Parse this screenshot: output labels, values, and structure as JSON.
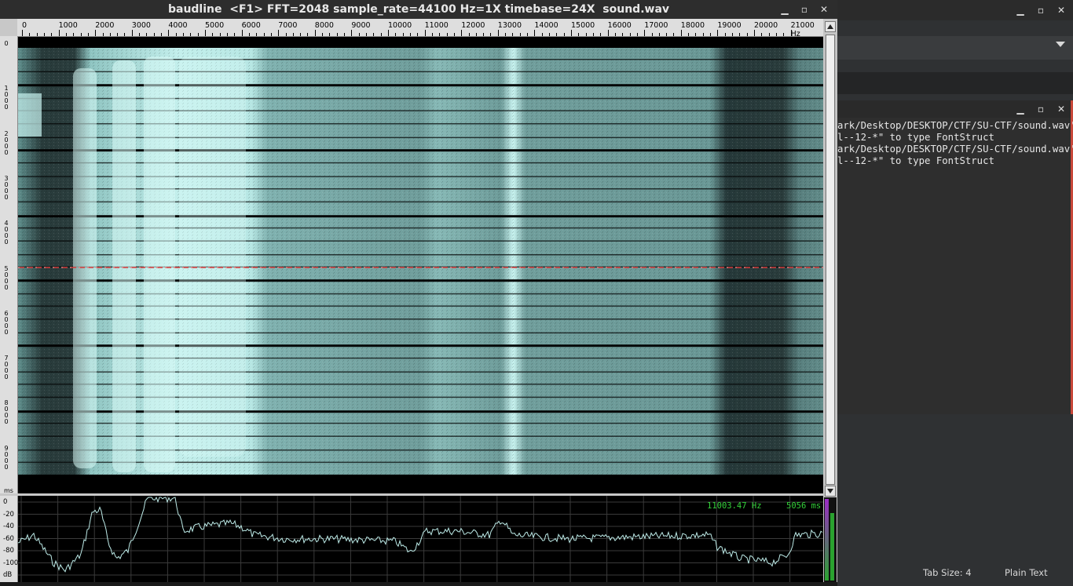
{
  "baudline": {
    "title": "baudline  <F1> FFT=2048 sample_rate=44100 Hz=1X timebase=24X  sound.wav",
    "window_buttons": {
      "minimize": "▪",
      "maximize": "▫",
      "close": "✕"
    },
    "freq_axis": {
      "labels": [
        "0",
        "1000",
        "2000",
        "3000",
        "4000",
        "5000",
        "6000",
        "7000",
        "8000",
        "9000",
        "10000",
        "11000",
        "12000",
        "13000",
        "14000",
        "15000",
        "16000",
        "17000",
        "18000",
        "19000",
        "20000",
        "21000 Hz"
      ]
    },
    "time_axis": {
      "labels": [
        "0",
        "1\n0\n0\n0",
        "2\n0\n0\n0",
        "3\n0\n0\n0",
        "4\n0\n0\n0",
        "5\n0\n0\n0",
        "6\n0\n0\n0",
        "7\n0\n0\n0",
        "8\n0\n0\n0",
        "9\n0\n0\n0"
      ],
      "unit": "ms"
    },
    "db_axis": {
      "labels": [
        "0",
        "-20",
        "-40",
        "-60",
        "-80",
        "-100"
      ],
      "unit": "dB"
    },
    "readout": {
      "frequency": "11003.47 Hz",
      "time": "5056 ms"
    },
    "colors": {
      "spectrogram": "#9ed7d4",
      "readout": "#34d13a",
      "cursor": "#d83c3c"
    }
  },
  "editor": {
    "status": {
      "tab_size": "Tab Size: 4",
      "syntax": "Plain Text"
    },
    "terminal_lines": [
      "ark/Desktop/DESKTOP/CTF/SU-CTF/sound.wav'",
      "l--12-*\" to type FontStruct",
      "ark/Desktop/DESKTOP/CTF/SU-CTF/sound.wav'",
      "l--12-*\" to type FontStruct"
    ]
  }
}
